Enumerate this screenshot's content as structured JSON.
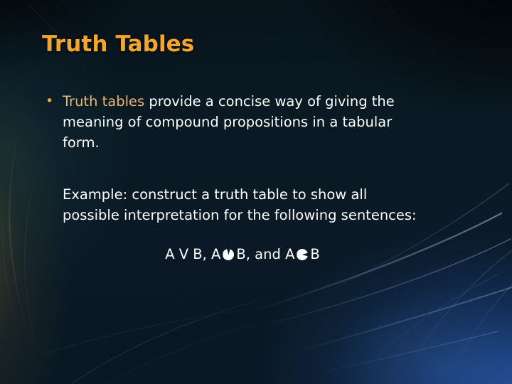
{
  "slide": {
    "title": "Truth Tables",
    "bullet": {
      "marker": "•",
      "highlighted_term": "Truth tables",
      "rest": " provide a concise way of giving the meaning of compound propositions in a tabular form."
    },
    "example_paragraph": "Example: construct a truth table to show all possible interpretation for the following sentences:",
    "formula": {
      "part_1": "A V B, A",
      "symbol_1_name": "implication-symbol-fallback-glyph",
      "part_2": "B, and A",
      "symbol_2_name": "biconditional-symbol-fallback-glyph",
      "part_3": "B"
    }
  },
  "theme": {
    "background_base": "#0a1720",
    "title_color": "#f4a62a",
    "highlight_color": "#e8b66f",
    "body_text_color": "#ffffff",
    "bullet_color": "#f0a73a",
    "glow_blue": "#2e60be",
    "glow_olive": "#786e2e"
  }
}
